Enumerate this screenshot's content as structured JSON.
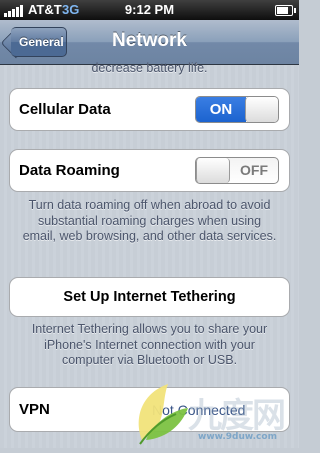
{
  "status_bar": {
    "carrier": "AT&T",
    "network": "3G",
    "time": "9:12 PM",
    "signal_bars": 5,
    "battery_level": 0.85
  },
  "nav": {
    "back_label": "General",
    "title": "Network"
  },
  "top_note": "decrease battery life.",
  "cellular_data": {
    "label": "Cellular Data",
    "switch_text": "ON",
    "state": "on"
  },
  "data_roaming": {
    "label": "Data Roaming",
    "switch_text": "OFF",
    "state": "off",
    "note": "Turn data roaming off when abroad to avoid substantial roaming charges when using email, web browsing, and other data services."
  },
  "tethering": {
    "label": "Set Up Internet Tethering",
    "note": "Internet Tethering allows you to share your iPhone's Internet connection with your computer via Bluetooth or USB."
  },
  "vpn": {
    "label": "VPN",
    "value": "Not Connected"
  },
  "watermark": {
    "text": "九度网",
    "url": "www.9duw.com"
  },
  "colors": {
    "switch_on": "#1c63cf",
    "navbar": "#6d84a2",
    "note_text": "#4c566c"
  }
}
